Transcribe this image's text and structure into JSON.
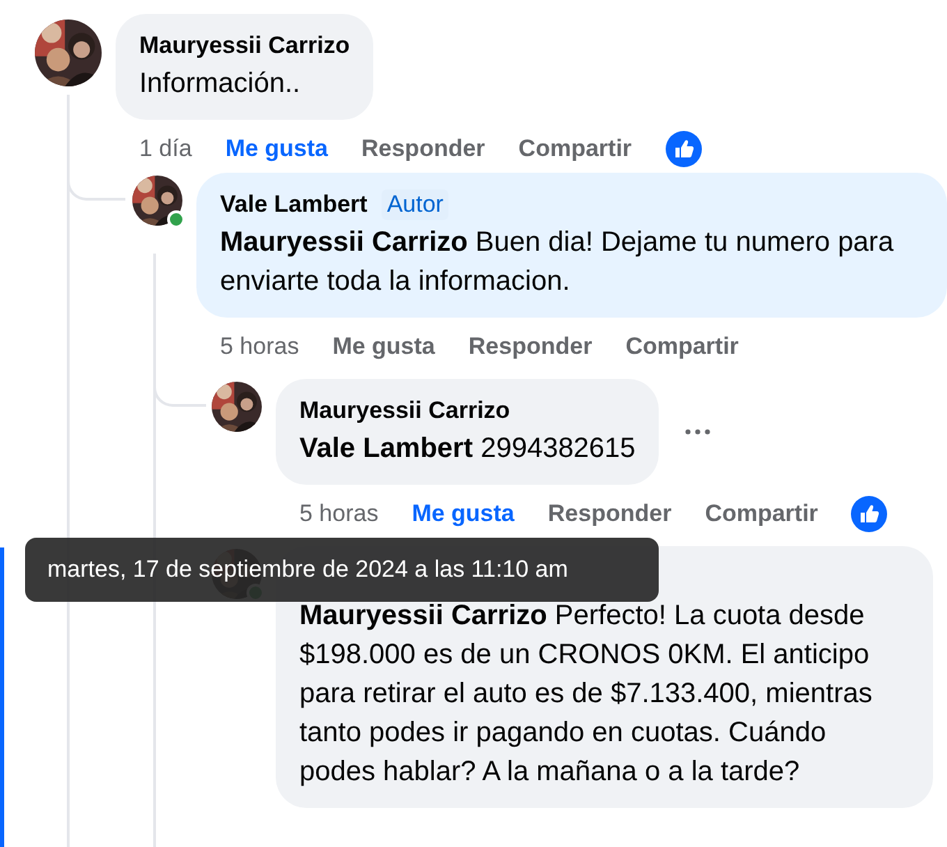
{
  "comments": [
    {
      "author": "Mauryessii Carrizo",
      "text": "Información..",
      "time": "1 día",
      "like_label": "Me gusta",
      "liked": true,
      "reply_label": "Responder",
      "share_label": "Compartir",
      "reaction_icon": true,
      "children": [
        {
          "author": "Vale Lambert",
          "badge": "Autor",
          "text": "**Mauryessii Carrizo** Buen dia! Dejame tu numero para enviarte toda la informacion.",
          "time": "5 horas",
          "like_label": "Me gusta",
          "liked": false,
          "reply_label": "Responder",
          "share_label": "Compartir",
          "online": true,
          "highlighted": true,
          "children": [
            {
              "author": "Mauryessii Carrizo",
              "text": "**Vale Lambert** 2994382615",
              "time": "5 horas",
              "like_label": "Me gusta",
              "liked": true,
              "reply_label": "Responder",
              "share_label": "Compartir",
              "reaction_icon": true,
              "more_button": true
            },
            {
              "text": "**Mauryessii Carrizo** Perfecto! La cuota desde $198.000 es de un CRONOS 0KM. El anticipo para retirar el auto es de $7.133.400, mientras tanto podes ir pagando en cuotas. Cuándo podes hablar? A la mañana o a la tarde?",
              "online": true
            }
          ]
        }
      ]
    }
  ],
  "tooltip": {
    "text": "martes, 17 de septiembre de 2024 a las 11:10 am"
  }
}
